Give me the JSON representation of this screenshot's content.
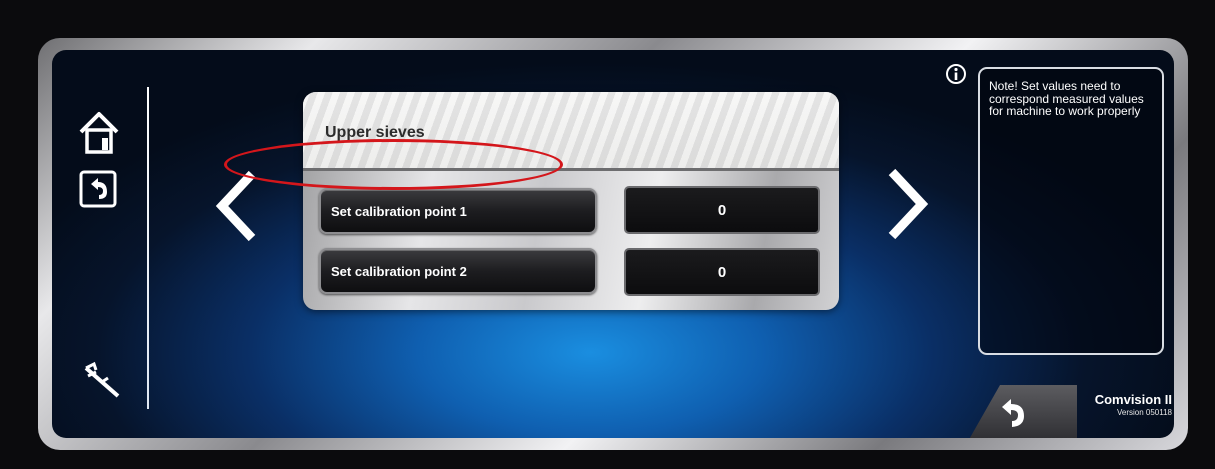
{
  "panel": {
    "title": "Upper sieves",
    "rows": [
      {
        "button_label": "Set calibration point 1",
        "value": "0"
      },
      {
        "button_label": "Set calibration point 2",
        "value": "0"
      }
    ]
  },
  "info": {
    "note": "Note! Set values need to correspond measured values for machine to work properly"
  },
  "brand": {
    "name": "Comvision II",
    "version": "Version 050118"
  },
  "icons": {
    "home": "home-icon",
    "back": "back-arrow-icon",
    "tool": "caliper-icon",
    "prev": "chevron-left-icon",
    "next": "chevron-right-icon",
    "info": "info-icon"
  },
  "colors": {
    "highlight": "#d4161b",
    "screen_blue": "#0f5fb0"
  }
}
